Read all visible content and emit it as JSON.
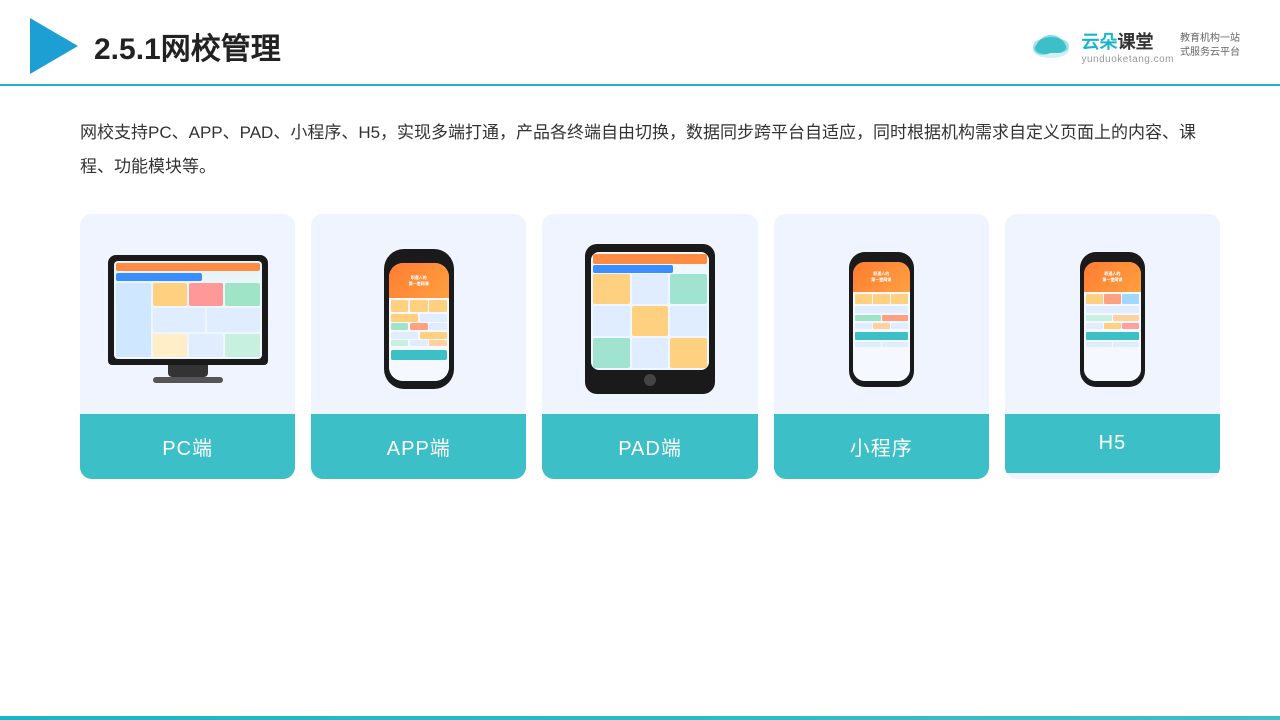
{
  "header": {
    "title": "2.5.1网校管理",
    "brand": {
      "name_part1": "云朵",
      "name_part2": "课堂",
      "url": "yunduoketang.com",
      "tagline_line1": "教育机构一站",
      "tagline_line2": "式服务云平台"
    }
  },
  "content": {
    "description": "网校支持PC、APP、PAD、小程序、H5，实现多端打通，产品各终端自由切换，数据同步跨平台自适应，同时根据机构需求自定义页面上的内容、课程、功能模块等。"
  },
  "cards": [
    {
      "id": "pc",
      "label": "PC端",
      "type": "monitor"
    },
    {
      "id": "app",
      "label": "APP端",
      "type": "phone"
    },
    {
      "id": "pad",
      "label": "PAD端",
      "type": "tablet"
    },
    {
      "id": "miniprogram",
      "label": "小程序",
      "type": "mini-phone"
    },
    {
      "id": "h5",
      "label": "H5",
      "type": "mini-phone2"
    }
  ],
  "colors": {
    "accent": "#1ab5c8",
    "card_bg": "#eef2f9",
    "card_label_bg": "#3dbfc8"
  }
}
